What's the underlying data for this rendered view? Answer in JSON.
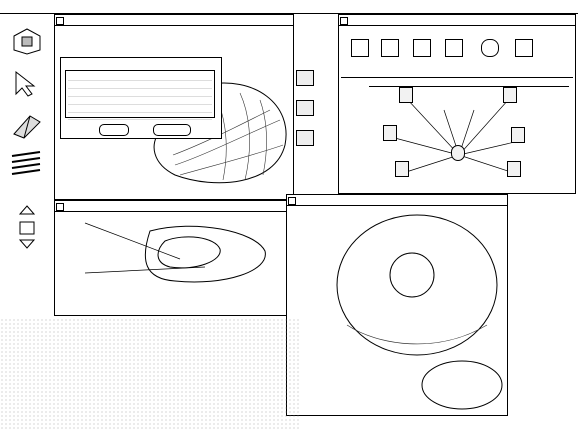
{
  "menubar": {
    "items": [
      "",
      "",
      "",
      "",
      "",
      "",
      "",
      "",
      "",
      "",
      "",
      "",
      ""
    ]
  },
  "windows": {
    "main_drawing": {
      "title": ""
    },
    "graph": {
      "title": "",
      "path": "",
      "nodes": [
        "",
        "",
        "",
        "",
        "",
        "",
        "",
        "",
        "",
        ""
      ]
    },
    "lower_left": {
      "title": "",
      "labels": [
        "",
        "",
        ""
      ]
    },
    "lower_right": {
      "title": "",
      "heading_lines": [
        "",
        "",
        ""
      ],
      "center_label": ""
    }
  },
  "dialog": {
    "title": "",
    "items": [
      "",
      "",
      "",
      "",
      "",
      ""
    ],
    "ok_label": "",
    "cancel_label": ""
  },
  "palette": {
    "tools": [
      "shape-tool-icon",
      "pointer-tool-icon",
      "cut-tool-icon",
      "lines-tool-icon"
    ]
  }
}
